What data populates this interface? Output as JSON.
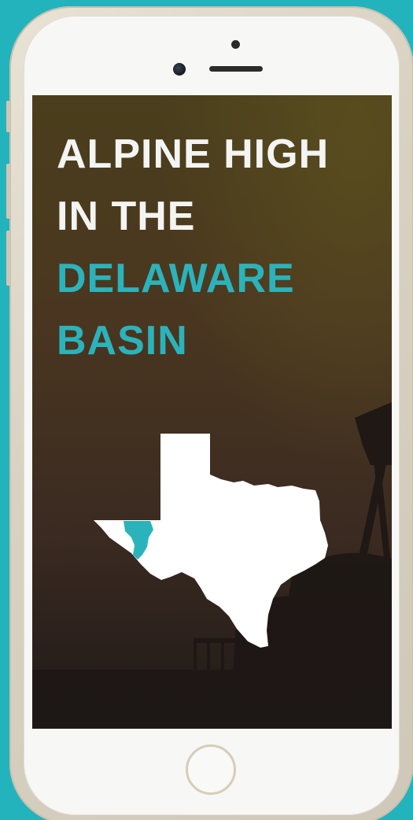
{
  "headline": {
    "line1": "ALPINE HIGH",
    "line2": "IN THE",
    "line3": "DELAWARE",
    "line4": "BASIN"
  },
  "colors": {
    "background": "#23b3bd",
    "headline_white": "#f4f4f2",
    "headline_teal": "#2bb3bc",
    "state_fill": "#ffffff",
    "region_highlight": "#2bb3bc",
    "screen_bg_top": "#4a3e1c",
    "screen_bg_bottom": "#1f1917"
  },
  "icons": {
    "map": "texas-state-map-icon",
    "highlight": "delaware-basin-region-icon",
    "home": "home-button-icon"
  }
}
